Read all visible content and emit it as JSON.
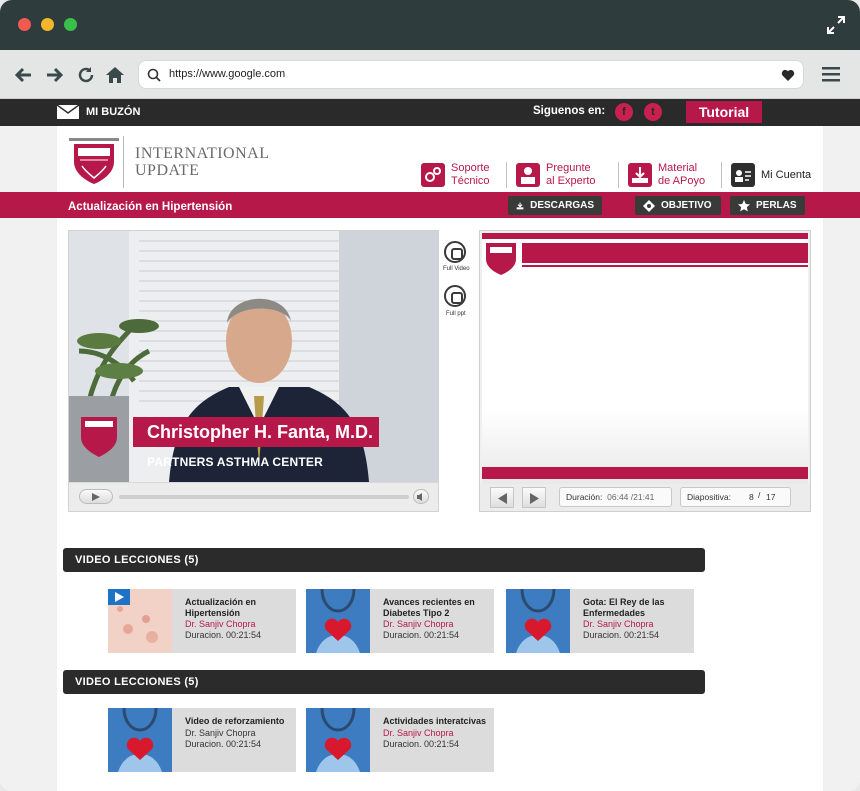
{
  "browser": {
    "url": "https://www.google.com"
  },
  "site_bar": {
    "mailbox_label": "MI BUZÓN",
    "follow_label": "Siguenos en:",
    "social": [
      "f",
      "t"
    ],
    "tutorial_label": "Tutorial"
  },
  "header": {
    "brand_line1": "INTERNATIONAL",
    "brand_line2": "UPDATE",
    "nav": [
      {
        "line1": "Soporte",
        "line2": "Técnico"
      },
      {
        "line1": "Pregunte",
        "line2": "al Experto"
      },
      {
        "line1": "Material",
        "line2": "de APoyo"
      },
      {
        "line1": "Mi Cuenta",
        "line2": ""
      }
    ]
  },
  "course_bar": {
    "title": "Actualización en Hipertensión",
    "buttons": [
      "DESCARGAS",
      "OBJETIVO",
      "PERLAS"
    ]
  },
  "player": {
    "speaker_name": "Christopher H. Fanta, M.D.",
    "speaker_org": "PARTNERS ASTHMA CENTER",
    "full_video_label": "Full Video",
    "full_ppt_label": "Full ppt"
  },
  "slides": {
    "duration_label": "Duración:",
    "duration_value": "06:44 /21:41",
    "slide_label": "Diapositiva:",
    "slide_current": "8",
    "slide_sep": "/",
    "slide_total": "17"
  },
  "sections": [
    {
      "title": "VIDEO LECCIONES (5)",
      "cards": [
        {
          "title": "Actualización en Hipertensión",
          "author": "Dr. Sanjiv Chopra",
          "duration": "Duracion. 00:21:54"
        },
        {
          "title": "Avances recientes en Diabetes Tipo 2",
          "author": "Dr. Sanjiv Chopra",
          "duration": "Duracion. 00:21:54"
        },
        {
          "title": "Gota: El Rey de las Enfermedades",
          "author": "Dr. Sanjiv Chopra",
          "duration": "Duracion. 00:21:54"
        }
      ]
    },
    {
      "title": "VIDEO LECCIONES (5)",
      "cards": [
        {
          "title": "Video de reforzamiento",
          "author": "Dr. Sanjiv Chopra",
          "duration": "Duracion. 00:21:54"
        },
        {
          "title": "Actividades interatcivas",
          "author": "Dr. Sanjiv Chopra",
          "duration": "Duracion. 00:21:54"
        }
      ]
    }
  ],
  "colors": {
    "accent": "#b7184a",
    "dark": "#2a2a2a",
    "titlebar": "#2f3c3d"
  }
}
